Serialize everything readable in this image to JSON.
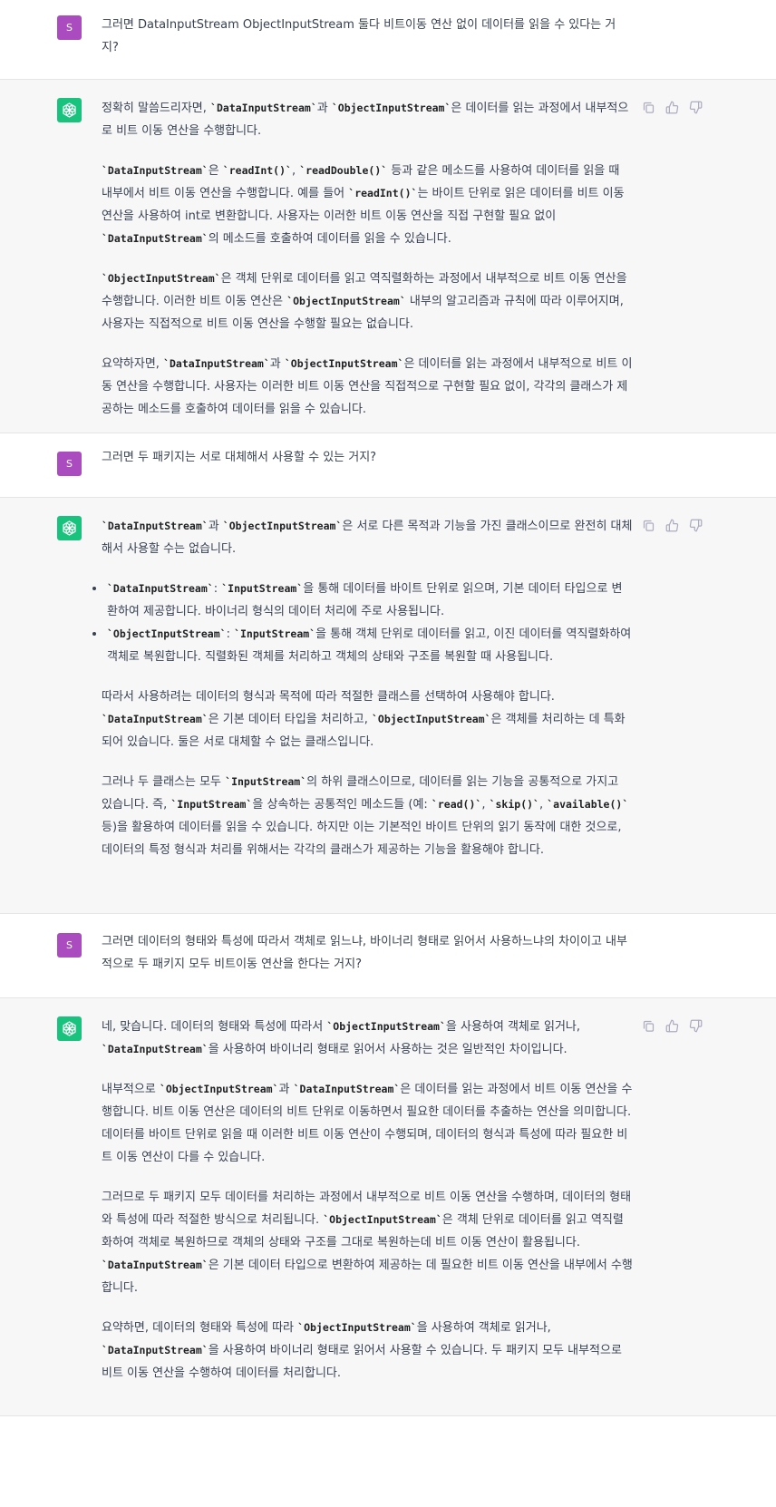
{
  "avatars": {
    "user_initial": "S"
  },
  "messages": [
    {
      "role": "user",
      "segments": [
        [
          {
            "t": "그러면 DataInputStream ObjectInputStream 둘다 비트이동 연산 없이 데이터를 읽을 수 있다는 거지?"
          }
        ]
      ]
    },
    {
      "role": "assistant",
      "segments": [
        [
          {
            "t": "정확히 말씀드리자면, "
          },
          {
            "c": "`DataInputStream`"
          },
          {
            "t": "과 "
          },
          {
            "c": "`ObjectInputStream`"
          },
          {
            "t": "은 데이터를 읽는 과정에서 내부적으로 비트 이동 연산을 수행합니다."
          }
        ],
        [
          {
            "c": "`DataInputStream`"
          },
          {
            "t": "은 "
          },
          {
            "c": "`readInt()`"
          },
          {
            "t": ", "
          },
          {
            "c": "`readDouble()`"
          },
          {
            "t": " 등과 같은 메소드를 사용하여 데이터를 읽을 때 내부에서 비트 이동 연산을 수행합니다. 예를 들어 "
          },
          {
            "c": "`readInt()`"
          },
          {
            "t": "는 바이트 단위로 읽은 데이터를 비트 이동 연산을 사용하여 int로 변환합니다. 사용자는 이러한 비트 이동 연산을 직접 구현할 필요 없이 "
          },
          {
            "c": "`DataInputStream`"
          },
          {
            "t": "의 메소드를 호출하여 데이터를 읽을 수 있습니다."
          }
        ],
        [
          {
            "c": "`ObjectInputStream`"
          },
          {
            "t": "은 객체 단위로 데이터를 읽고 역직렬화하는 과정에서 내부적으로 비트 이동 연산을 수행합니다. 이러한 비트 이동 연산은 "
          },
          {
            "c": "`ObjectInputStream`"
          },
          {
            "t": " 내부의 알고리즘과 규칙에 따라 이루어지며, 사용자는 직접적으로 비트 이동 연산을 수행할 필요는 없습니다."
          }
        ],
        [
          {
            "t": "요약하자면, "
          },
          {
            "c": "`DataInputStream`"
          },
          {
            "t": "과 "
          },
          {
            "c": "`ObjectInputStream`"
          },
          {
            "t": "은 데이터를 읽는 과정에서 내부적으로 비트 이동 연산을 수행합니다. 사용자는 이러한 비트 이동 연산을 직접적으로 구현할 필요 없이, 각각의 클래스가 제공하는 메소드를 호출하여 데이터를 읽을 수 있습니다."
          }
        ]
      ]
    },
    {
      "role": "user",
      "segments": [
        [
          {
            "t": "그러면 두 패키지는 서로 대체해서 사용할 수 있는 거지?"
          }
        ]
      ]
    },
    {
      "role": "assistant",
      "segments": [
        [
          {
            "c": "`DataInputStream`"
          },
          {
            "t": "과 "
          },
          {
            "c": "`ObjectInputStream`"
          },
          {
            "t": "은 서로 다른 목적과 기능을 가진 클래스이므로 완전히 대체해서 사용할 수는 없습니다."
          }
        ],
        {
          "list": [
            [
              {
                "c": "`DataInputStream`"
              },
              {
                "t": ": "
              },
              {
                "c": "`InputStream`"
              },
              {
                "t": "을 통해 데이터를 바이트 단위로 읽으며, 기본 데이터 타입으로 변환하여 제공합니다. 바이너리 형식의 데이터 처리에 주로 사용됩니다."
              }
            ],
            [
              {
                "c": "`ObjectInputStream`"
              },
              {
                "t": ": "
              },
              {
                "c": "`InputStream`"
              },
              {
                "t": "을 통해 객체 단위로 데이터를 읽고, 이진 데이터를 역직렬화하여 객체로 복원합니다. 직렬화된 객체를 처리하고 객체의 상태와 구조를 복원할 때 사용됩니다."
              }
            ]
          ]
        },
        [
          {
            "t": "따라서 사용하려는 데이터의 형식과 목적에 따라 적절한 클래스를 선택하여 사용해야 합니다. "
          },
          {
            "c": "`DataInputStream`"
          },
          {
            "t": "은 기본 데이터 타입을 처리하고, "
          },
          {
            "c": "`ObjectInputStream`"
          },
          {
            "t": "은 객체를 처리하는 데 특화되어 있습니다. 둘은 서로 대체할 수 없는 클래스입니다."
          }
        ],
        [
          {
            "t": "그러나 두 클래스는 모두 "
          },
          {
            "c": "`InputStream`"
          },
          {
            "t": "의 하위 클래스이므로, 데이터를 읽는 기능을 공통적으로 가지고 있습니다. 즉, "
          },
          {
            "c": "`InputStream`"
          },
          {
            "t": "을 상속하는 공통적인 메소드들 (예: "
          },
          {
            "c": "`read()`"
          },
          {
            "t": ", "
          },
          {
            "c": "`skip()`"
          },
          {
            "t": ", "
          },
          {
            "c": "`available()`"
          },
          {
            "t": " 등)을 활용하여 데이터를 읽을 수 있습니다. 하지만 이는 기본적인 바이트 단위의 읽기 동작에 대한 것으로, 데이터의 특정 형식과 처리를 위해서는 각각의 클래스가 제공하는 기능을 활용해야 합니다."
          }
        ]
      ]
    },
    {
      "role": "user",
      "segments": [
        [
          {
            "t": "그러면 데이터의 형태와 특성에 따라서 객체로 읽느냐, 바이너리 형태로 읽어서 사용하느냐의 차이이고 내부적으로 두 패키지 모두 비트이동 연산을 한다는 거지?"
          }
        ]
      ]
    },
    {
      "role": "assistant",
      "segments": [
        [
          {
            "t": "네, 맞습니다. 데이터의 형태와 특성에 따라서 "
          },
          {
            "c": "`ObjectInputStream`"
          },
          {
            "t": "을 사용하여 객체로 읽거나, "
          },
          {
            "c": "`DataInputStream`"
          },
          {
            "t": "을 사용하여 바이너리 형태로 읽어서 사용하는 것은 일반적인 차이입니다."
          }
        ],
        [
          {
            "t": "내부적으로 "
          },
          {
            "c": "`ObjectInputStream`"
          },
          {
            "t": "과 "
          },
          {
            "c": "`DataInputStream`"
          },
          {
            "t": "은 데이터를 읽는 과정에서 비트 이동 연산을 수행합니다. 비트 이동 연산은 데이터의 비트 단위로 이동하면서 필요한 데이터를 추출하는 연산을 의미합니다. 데이터를 바이트 단위로 읽을 때 이러한 비트 이동 연산이 수행되며, 데이터의 형식과 특성에 따라 필요한 비트 이동 연산이 다를 수 있습니다."
          }
        ],
        [
          {
            "t": "그러므로 두 패키지 모두 데이터를 처리하는 과정에서 내부적으로 비트 이동 연산을 수행하며, 데이터의 형태와 특성에 따라 적절한 방식으로 처리됩니다. "
          },
          {
            "c": "`ObjectInputStream`"
          },
          {
            "t": "은 객체 단위로 데이터를 읽고 역직렬화하여 객체로 복원하므로 객체의 상태와 구조를 그대로 복원하는데 비트 이동 연산이 활용됩니다. "
          },
          {
            "c": "`DataInputStream`"
          },
          {
            "t": "은 기본 데이터 타입으로 변환하여 제공하는 데 필요한 비트 이동 연산을 내부에서 수행합니다."
          }
        ],
        [
          {
            "t": "요약하면, 데이터의 형태와 특성에 따라 "
          },
          {
            "c": "`ObjectInputStream`"
          },
          {
            "t": "을 사용하여 객체로 읽거나, "
          },
          {
            "c": "`DataInputStream`"
          },
          {
            "t": "을 사용하여 바이너리 형태로 읽어서 사용할 수 있습니다. 두 패키지 모두 내부적으로 비트 이동 연산을 수행하여 데이터를 처리합니다."
          }
        ]
      ]
    }
  ]
}
